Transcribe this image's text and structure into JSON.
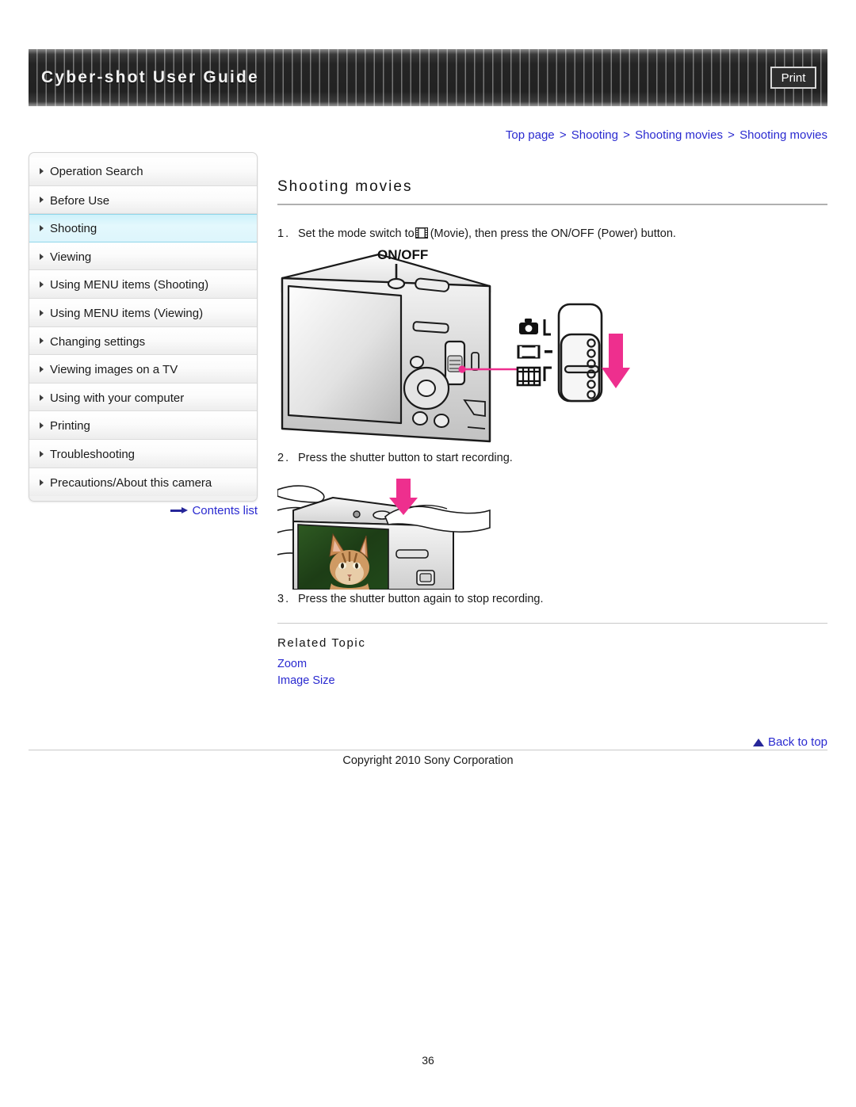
{
  "header": {
    "title": "Cyber-shot User Guide",
    "print_label": "Print"
  },
  "breadcrumb": {
    "items": [
      "Top page",
      "Shooting",
      "Shooting movies",
      "Shooting movies"
    ],
    "separator": ">"
  },
  "sidebar": {
    "items": [
      {
        "label": "Operation Search",
        "active": false
      },
      {
        "label": "Before Use",
        "active": false
      },
      {
        "label": "Shooting",
        "active": true
      },
      {
        "label": "Viewing",
        "active": false
      },
      {
        "label": "Using MENU items (Shooting)",
        "active": false
      },
      {
        "label": "Using MENU items (Viewing)",
        "active": false
      },
      {
        "label": "Changing settings",
        "active": false
      },
      {
        "label": "Viewing images on a TV",
        "active": false
      },
      {
        "label": "Using with your computer",
        "active": false
      },
      {
        "label": "Printing",
        "active": false
      },
      {
        "label": "Troubleshooting",
        "active": false
      },
      {
        "label": "Precautions/About this camera",
        "active": false
      }
    ],
    "contents_list_label": "Contents list"
  },
  "main": {
    "title": "Shooting movies",
    "steps": [
      {
        "num": "1.",
        "text_before": "Set the mode switch to",
        "icon": "film-strip-icon",
        "text_after": "(Movie), then press the ON/OFF (Power) button."
      },
      {
        "num": "2.",
        "text_before": "Press the shutter button to start recording.",
        "icon": null,
        "text_after": ""
      },
      {
        "num": "3.",
        "text_before": "Press the shutter button again to stop recording.",
        "icon": null,
        "text_after": ""
      }
    ],
    "figure1": {
      "onoff_label": "ON/OFF",
      "mode_icons": [
        "still-camera-icon",
        "panorama-icon",
        "movie-film-icon"
      ],
      "arrow_color": "#f0388c"
    },
    "figure2": {
      "arrow_color": "#e91e8c",
      "lcd_subject": "cat"
    },
    "related_topic": {
      "heading": "Related Topic",
      "links": [
        "Zoom",
        "Image Size"
      ]
    }
  },
  "footer": {
    "back_to_top_label": "Back to top",
    "copyright": "Copyright 2010 Sony Corporation",
    "page_number": "36"
  },
  "colors": {
    "link": "#2a2ad0",
    "accent_pink": "#ee2f8e",
    "active_nav": "#cdf1fa",
    "header_bg": "#242424"
  }
}
